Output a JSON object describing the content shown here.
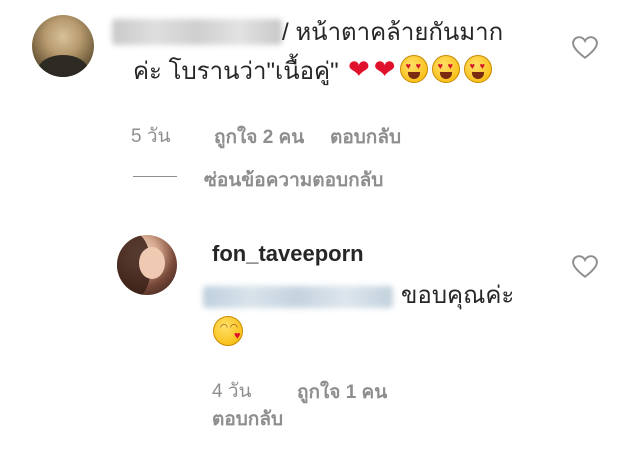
{
  "comment1": {
    "text_line1": "/ หน้าตาคล้ายกันมาก",
    "text_line2": "ค่ะ โบรานว่า\"เนื้อคู่\"",
    "emojis": [
      "red-heart",
      "red-heart",
      "smiling-face-with-hearts",
      "heart-eyes",
      "heart-eyes"
    ],
    "time": "5 วัน",
    "likes": "ถูกใจ 2 คน",
    "reply_label": "ตอบกลับ",
    "hide_replies_label": "ซ่อนข้อความตอบกลับ"
  },
  "reply1": {
    "username": "fon_taveeporn",
    "text": "ขอบคุณค่ะ",
    "emoji": "face-blowing-kiss",
    "time": "4 วัน",
    "likes": "ถูกใจ 1 คน",
    "reply_label": "ตอบกลับ"
  },
  "colors": {
    "text": "#262626",
    "muted": "#8e8e8e",
    "heart": "#e0112b"
  },
  "icons": {
    "like": "heart-outline-icon"
  }
}
